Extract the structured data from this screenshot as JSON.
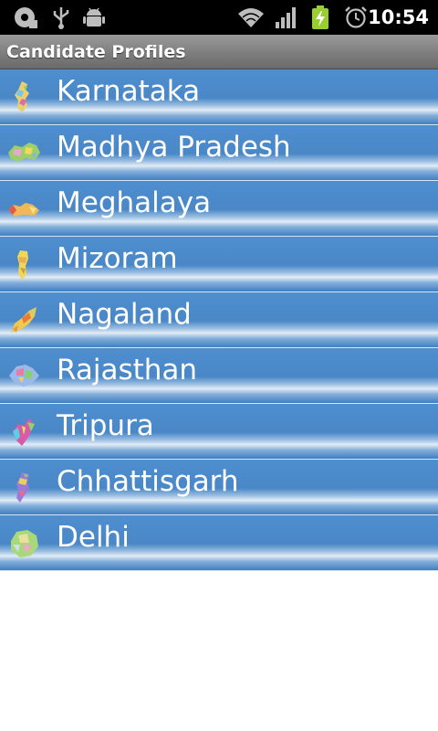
{
  "status_bar": {
    "time": "10:54",
    "icons": [
      "sd-card-icon",
      "usb-icon",
      "android-debug-icon",
      "wifi-icon",
      "signal-icon",
      "battery-charging-icon",
      "alarm-icon"
    ]
  },
  "title_bar": {
    "title": "Candidate Profiles"
  },
  "states": [
    {
      "label": "Karnataka",
      "icon": "karnataka-map-icon"
    },
    {
      "label": "Madhya Pradesh",
      "icon": "madhya-pradesh-map-icon"
    },
    {
      "label": "Meghalaya",
      "icon": "meghalaya-map-icon"
    },
    {
      "label": "Mizoram",
      "icon": "mizoram-map-icon"
    },
    {
      "label": "Nagaland",
      "icon": "nagaland-map-icon"
    },
    {
      "label": "Rajasthan",
      "icon": "rajasthan-map-icon"
    },
    {
      "label": "Tripura",
      "icon": "tripura-map-icon"
    },
    {
      "label": "Chhattisgarh",
      "icon": "chhattisgarh-map-icon"
    },
    {
      "label": "Delhi",
      "icon": "delhi-map-icon"
    }
  ],
  "colors": {
    "row_blue": "#4a88c8",
    "title_gray": "#7e7e7e",
    "status_black": "#000000"
  }
}
